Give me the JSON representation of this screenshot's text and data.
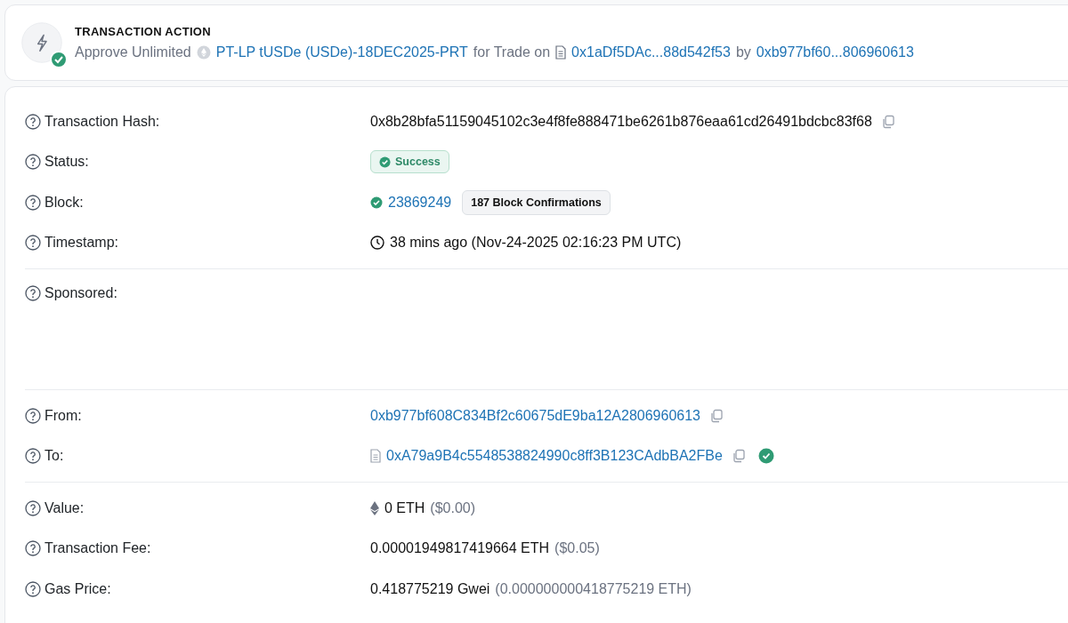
{
  "action": {
    "title": "TRANSACTION ACTION",
    "verified": true,
    "parts": [
      {
        "kind": "text",
        "text": "Approve Unlimited"
      },
      {
        "kind": "token",
        "text": "PT-LP tUSDe (USDe)-18DEC2025-PRT"
      },
      {
        "kind": "text",
        "text": "for Trade on"
      },
      {
        "kind": "contract",
        "text": "0x1aDf5DAc...88d542f53"
      },
      {
        "kind": "text",
        "text": "by"
      },
      {
        "kind": "link",
        "text": "0xb977bf60...806960613"
      }
    ]
  },
  "sections": [
    {
      "rows": [
        {
          "kind": "hash",
          "label": "Transaction Hash:",
          "value": "0x8b28bfa51159045102c3e4f8fe888471be6261b876eaa61cd26491bdcbc83f68"
        },
        {
          "kind": "status",
          "label": "Status:",
          "value": "Success"
        },
        {
          "kind": "block",
          "label": "Block:",
          "value": "23869249",
          "confirmations": "187 Block Confirmations"
        },
        {
          "kind": "time",
          "label": "Timestamp:",
          "value": "38 mins ago (Nov-24-2025 02:16:23 PM UTC)"
        }
      ]
    },
    {
      "rows": [
        {
          "kind": "empty",
          "label": "Sponsored:"
        }
      ]
    },
    {
      "rows": [
        {
          "kind": "from",
          "label": "From:",
          "value": "0xb977bf608C834Bf2c60675dE9ba12A2806960613"
        },
        {
          "kind": "to",
          "label": "To:",
          "value": "0xA79a9B4c5548538824990c8ff3B123CAdbBA2FBe",
          "verified": true
        }
      ]
    },
    {
      "rows": [
        {
          "kind": "value",
          "label": "Value:",
          "value": "0 ETH",
          "usd": "($0.00)"
        },
        {
          "kind": "amount",
          "label": "Transaction Fee:",
          "value": "0.00001949817419664 ETH",
          "usd": "($0.05)"
        },
        {
          "kind": "amount",
          "label": "Gas Price:",
          "value": "0.418775219 Gwei",
          "usd": "(0.000000000418775219 ETH)"
        }
      ]
    }
  ]
}
